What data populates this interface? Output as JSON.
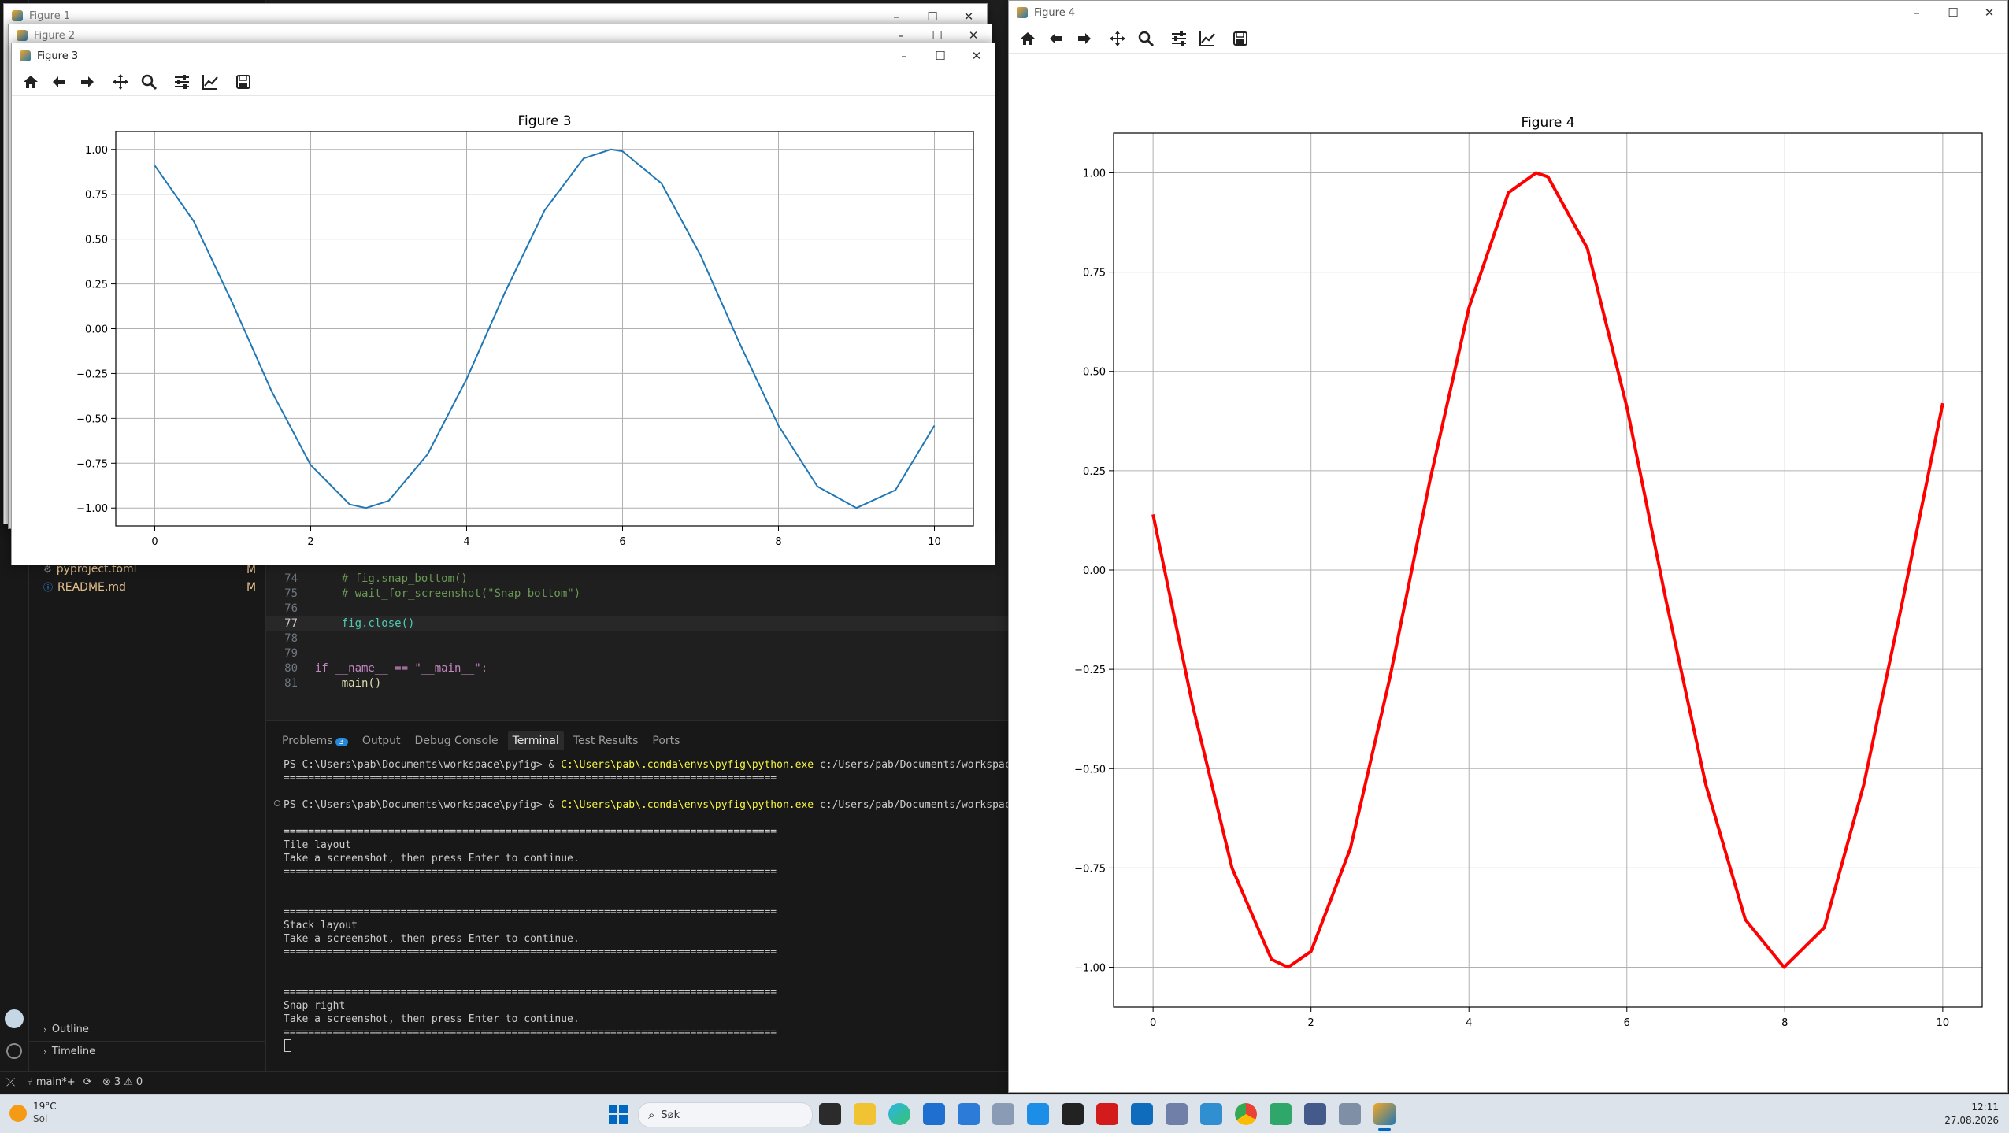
{
  "vscode": {
    "files": [
      {
        "name": "pyproject.toml",
        "status": "M"
      },
      {
        "name": "README.md",
        "status": "M"
      }
    ],
    "code_lines": [
      {
        "num": "74",
        "text": "    # fig.snap_bottom()",
        "kind": "comment"
      },
      {
        "num": "75",
        "text": "    # wait_for_screenshot(\"Snap bottom\")",
        "kind": "comment"
      },
      {
        "num": "76",
        "text": "",
        "kind": "plain"
      },
      {
        "num": "77",
        "text": "    fig.close()",
        "kind": "call"
      },
      {
        "num": "78",
        "text": "",
        "kind": "plain"
      },
      {
        "num": "79",
        "text": "",
        "kind": "plain"
      },
      {
        "num": "80",
        "text": "if __name__ == \"__main__\":",
        "kind": "main"
      },
      {
        "num": "81",
        "text": "    main()",
        "kind": "call2"
      }
    ],
    "panel_tabs": [
      {
        "label": "Problems",
        "badge": "3"
      },
      {
        "label": "Output"
      },
      {
        "label": "Debug Console"
      },
      {
        "label": "Terminal",
        "active": true
      },
      {
        "label": "Test Results"
      },
      {
        "label": "Ports"
      }
    ],
    "terminal_lines": [
      {
        "prompt": "PS C:\\Users\\pab\\Documents\\workspace\\pyfig> & ",
        "exe": "C:\\Users\\pab\\.conda\\envs\\pyfig\\python.exe",
        "rest": " c:/Users/pab/Documents/workspace/pyfig/gener"
      },
      {
        "text": "================================================================================"
      },
      {
        "text": ""
      },
      {
        "prompt": "PS C:\\Users\\pab\\Documents\\workspace\\pyfig> & ",
        "exe": "C:\\Users\\pab\\.conda\\envs\\pyfig\\python.exe",
        "rest": " c:/Users/pab/Documents/workspace/pyfig/gener"
      },
      {
        "text": ""
      },
      {
        "text": "================================================================================"
      },
      {
        "text": "Tile layout"
      },
      {
        "text": "Take a screenshot, then press Enter to continue."
      },
      {
        "text": "================================================================================"
      },
      {
        "text": ""
      },
      {
        "text": ""
      },
      {
        "text": "================================================================================"
      },
      {
        "text": "Stack layout"
      },
      {
        "text": "Take a screenshot, then press Enter to continue."
      },
      {
        "text": "================================================================================"
      },
      {
        "text": ""
      },
      {
        "text": ""
      },
      {
        "text": "================================================================================"
      },
      {
        "text": "Snap right"
      },
      {
        "text": "Take a screenshot, then press Enter to continue."
      },
      {
        "text": "================================================================================"
      }
    ],
    "outline_label": "Outline",
    "timeline_label": "Timeline",
    "status": {
      "branch": "main*+",
      "errors": "3",
      "warnings": "0"
    }
  },
  "windows": {
    "figure1_title": "Figure 1",
    "figure2_title": "Figure 2",
    "figure3_title": "Figure 3",
    "figure4_title": "Figure 4"
  },
  "toolbar_icons": [
    "home-icon",
    "back-icon",
    "forward-icon",
    "pan-icon",
    "zoom-icon",
    "configure-subplots-icon",
    "edit-axis-icon",
    "save-icon"
  ],
  "chart_data": [
    {
      "type": "line",
      "title": "Figure 3",
      "xlabel": "",
      "ylabel": "",
      "xlim": [
        -0.5,
        10.5
      ],
      "ylim": [
        -1.1,
        1.1
      ],
      "xticks": [
        0,
        2,
        4,
        6,
        8,
        10
      ],
      "yticks": [
        1.0,
        0.75,
        0.5,
        0.25,
        0.0,
        -0.25,
        -0.5,
        -0.75,
        -1.0
      ],
      "xtick_labels": [
        "0",
        "2",
        "4",
        "6",
        "8",
        "10"
      ],
      "ytick_labels": [
        "1.00",
        "0.75",
        "0.50",
        "0.25",
        "0.00",
        "−0.25",
        "−0.50",
        "−0.75",
        "−1.00"
      ],
      "grid": true,
      "series": [
        {
          "function": "sin",
          "color": "#1f77b4",
          "x": [
            0,
            0.5,
            1,
            1.5,
            2,
            2.5,
            2.71,
            3,
            3.5,
            4,
            4.5,
            5,
            5.5,
            5.85,
            6,
            6.5,
            7,
            7.5,
            8,
            8.5,
            9,
            9.5,
            10
          ],
          "y": [
            0.91,
            0.6,
            0.14,
            -0.35,
            -0.76,
            -0.98,
            -1.0,
            -0.96,
            -0.7,
            -0.28,
            0.21,
            0.66,
            0.95,
            1.0,
            0.99,
            0.81,
            0.41,
            -0.08,
            -0.54,
            -0.88,
            -1.0,
            -0.9,
            -0.54
          ]
        }
      ]
    },
    {
      "type": "line",
      "title": "Figure 4",
      "xlabel": "",
      "ylabel": "",
      "xlim": [
        -0.5,
        10.5
      ],
      "ylim": [
        -1.1,
        1.1
      ],
      "xticks": [
        0,
        2,
        4,
        6,
        8,
        10
      ],
      "yticks": [
        1.0,
        0.75,
        0.5,
        0.25,
        0.0,
        -0.25,
        -0.5,
        -0.75,
        -1.0
      ],
      "xtick_labels": [
        "0",
        "2",
        "4",
        "6",
        "8",
        "10"
      ],
      "ytick_labels": [
        "1.00",
        "0.75",
        "0.50",
        "0.25",
        "0.00",
        "−0.25",
        "−0.50",
        "−0.75",
        "−1.00"
      ],
      "grid": true,
      "series": [
        {
          "function": "sin",
          "color": "#ff0000",
          "x": [
            0,
            0.5,
            1,
            1.5,
            1.71,
            2,
            2.5,
            3,
            3.5,
            4,
            4.5,
            4.85,
            5,
            5.5,
            6,
            6.5,
            7,
            7.5,
            7.99,
            8.5,
            9,
            9.5,
            10
          ],
          "y": [
            0.14,
            -0.34,
            -0.75,
            -0.98,
            -1.0,
            -0.96,
            -0.7,
            -0.27,
            0.22,
            0.66,
            0.95,
            1.0,
            0.99,
            0.81,
            0.41,
            -0.08,
            -0.54,
            -0.88,
            -1.0,
            -0.9,
            -0.54,
            -0.07,
            0.42
          ]
        }
      ]
    }
  ],
  "taskbar": {
    "weather_temp": "19°C",
    "weather_desc": "Sol",
    "search_placeholder": "Søk",
    "time": "12:11",
    "date": "27.08.2026"
  }
}
